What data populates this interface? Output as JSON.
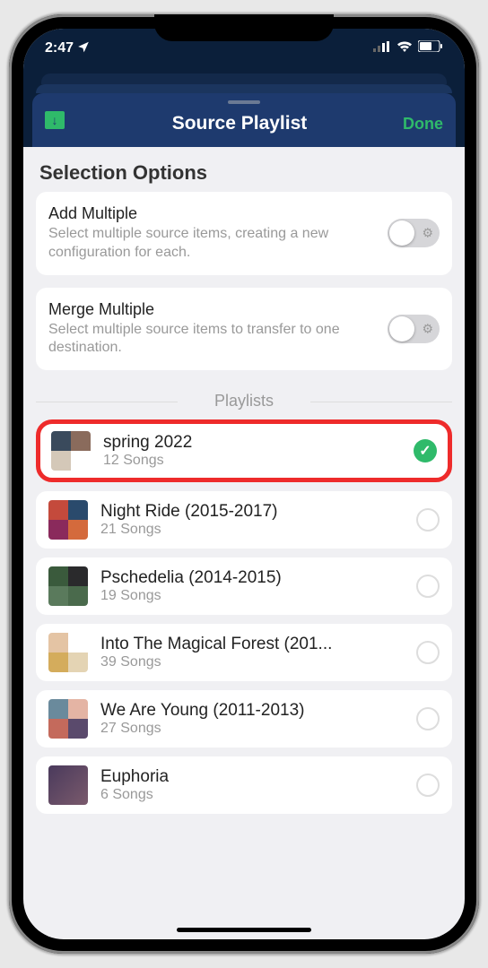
{
  "status": {
    "time": "2:47",
    "location_arrow": "➤"
  },
  "nav": {
    "title": "Source Playlist",
    "done_label": "Done"
  },
  "section": {
    "title": "Selection Options"
  },
  "options": [
    {
      "title": "Add Multiple",
      "desc": "Select multiple source items, creating a new configuration for each."
    },
    {
      "title": "Merge Multiple",
      "desc": "Select multiple source items to transfer to one destination."
    }
  ],
  "playlists_header": "Playlists",
  "playlists": [
    {
      "name": "spring 2022",
      "songs": "12 Songs",
      "selected": true,
      "highlighted": true
    },
    {
      "name": "Night Ride (2015-2017)",
      "songs": "21 Songs",
      "selected": false
    },
    {
      "name": "Pschedelia (2014-2015)",
      "songs": "19 Songs",
      "selected": false
    },
    {
      "name": "Into The Magical Forest (201...",
      "songs": "39 Songs",
      "selected": false
    },
    {
      "name": "We Are Young (2011-2013)",
      "songs": "27 Songs",
      "selected": false
    },
    {
      "name": "Euphoria",
      "songs": "6 Songs",
      "selected": false
    }
  ]
}
